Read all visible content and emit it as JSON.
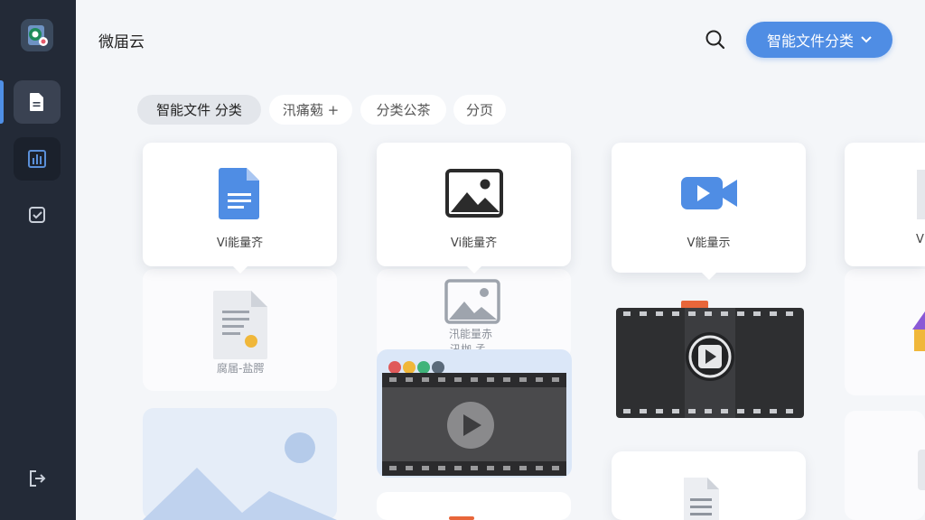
{
  "app": {
    "title": "微届云"
  },
  "header": {
    "primary_button_label": "智能文件分类"
  },
  "filters": [
    {
      "label": "智能文件  分类",
      "active": true
    },
    {
      "label": "汛痛葂 +",
      "active": false
    },
    {
      "label": "分类公茶",
      "active": false
    },
    {
      "label": "分页",
      "active": false
    }
  ],
  "cards": [
    {
      "label": "Vi能量齐",
      "icon": "document-icon"
    },
    {
      "label": "Vi能量齐",
      "icon": "image-icon"
    },
    {
      "label": "V能量示",
      "icon": "video-camera-icon"
    },
    {
      "label": "V",
      "icon": "file-icon"
    }
  ],
  "faded": {
    "doc_label": "腐届-盐腭",
    "image_label_1": "汛能量赤",
    "image_label_2": "汛枷 孟"
  },
  "colors": {
    "accent": "#4f8de4",
    "sidebar": "#232a37"
  }
}
